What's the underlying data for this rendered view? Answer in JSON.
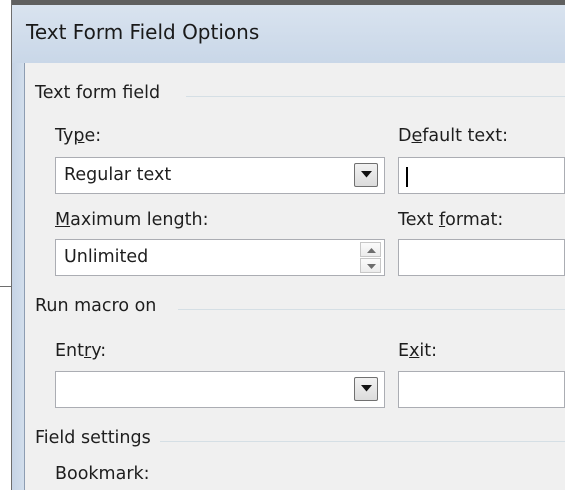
{
  "dialog": {
    "title": "Text Form Field Options"
  },
  "text_form_field": {
    "group_label": "Text form field",
    "type": {
      "label_pre": "Ty",
      "label_accel": "p",
      "label_post": "e:",
      "value": "Regular text"
    },
    "default_text": {
      "label_pre": "D",
      "label_accel": "e",
      "label_post": "fault text:",
      "value": ""
    },
    "maximum_length": {
      "label_pre": "",
      "label_accel": "M",
      "label_post": "aximum length:",
      "value": "Unlimited"
    },
    "text_format": {
      "label_pre": "Text ",
      "label_accel": "f",
      "label_post": "ormat:",
      "value": ""
    }
  },
  "run_macro_on": {
    "group_label": "Run macro on",
    "entry": {
      "label_pre": "Ent",
      "label_accel": "r",
      "label_post": "y:",
      "value": ""
    },
    "exit": {
      "label_pre": "E",
      "label_accel": "x",
      "label_post": "it:",
      "value": ""
    }
  },
  "field_settings": {
    "group_label": "Field settings",
    "bookmark_label": "Bookmark:"
  },
  "icons": {
    "dropdown": "chevron-down-icon",
    "spin_up": "spin-up-icon",
    "spin_down": "spin-down-icon"
  }
}
